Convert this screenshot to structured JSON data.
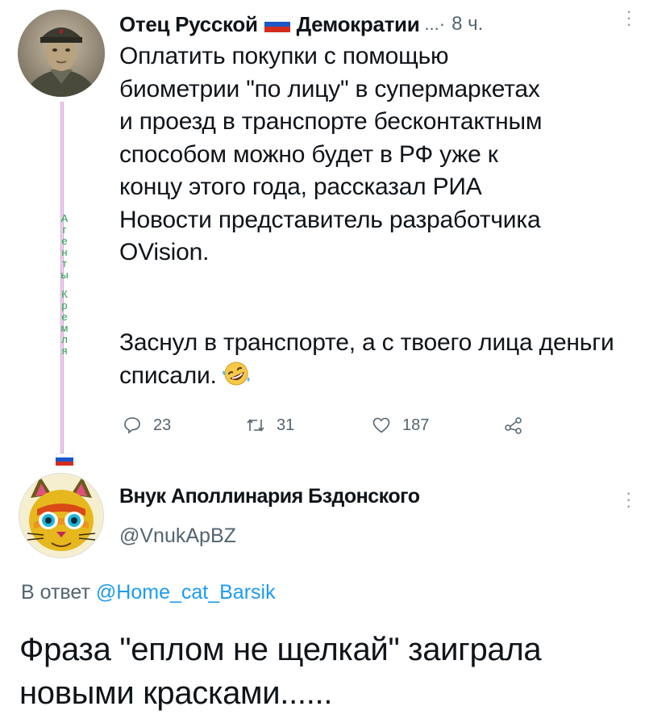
{
  "tweet1": {
    "author_name": "Отец Русской",
    "author_name_2": "Демократии",
    "separator": "...·",
    "time": "8 ч.",
    "body_paragraph_1": "Оплатить покупки с помощью\nбиометрии \"по лицу\" в супермаркетах\nи проезд в транспорте бесконтактным\nспособом можно будет в РФ уже к\nконцу этого года, рассказал РИА\nНовости представитель разработчика\nOVision.",
    "body_paragraph_2": "Заснул в транспорте, а с твоего лица деньги списали.",
    "emoji": "rolling-on-floor-laughing-emoji",
    "stats": {
      "replies": "23",
      "retweets": "31",
      "likes": "187"
    },
    "thread_letters": [
      "А",
      "г",
      "е",
      "н",
      "т",
      "ы",
      "",
      "К",
      "р",
      "е",
      "м",
      "л",
      "я"
    ]
  },
  "tweet2": {
    "author_name": "Внук Аполлинария Бздонского",
    "handle": "@VnukApBZ",
    "reply_prefix": "В ответ",
    "reply_to": "@Home_cat_Barsik",
    "body": "Фраза \"еплом не щелкай\" заиграла новыми красками......"
  },
  "colors": {
    "text": "#0f1419",
    "secondary": "#536471",
    "link": "#1d9bf0",
    "thread_green": "#22a34a"
  }
}
